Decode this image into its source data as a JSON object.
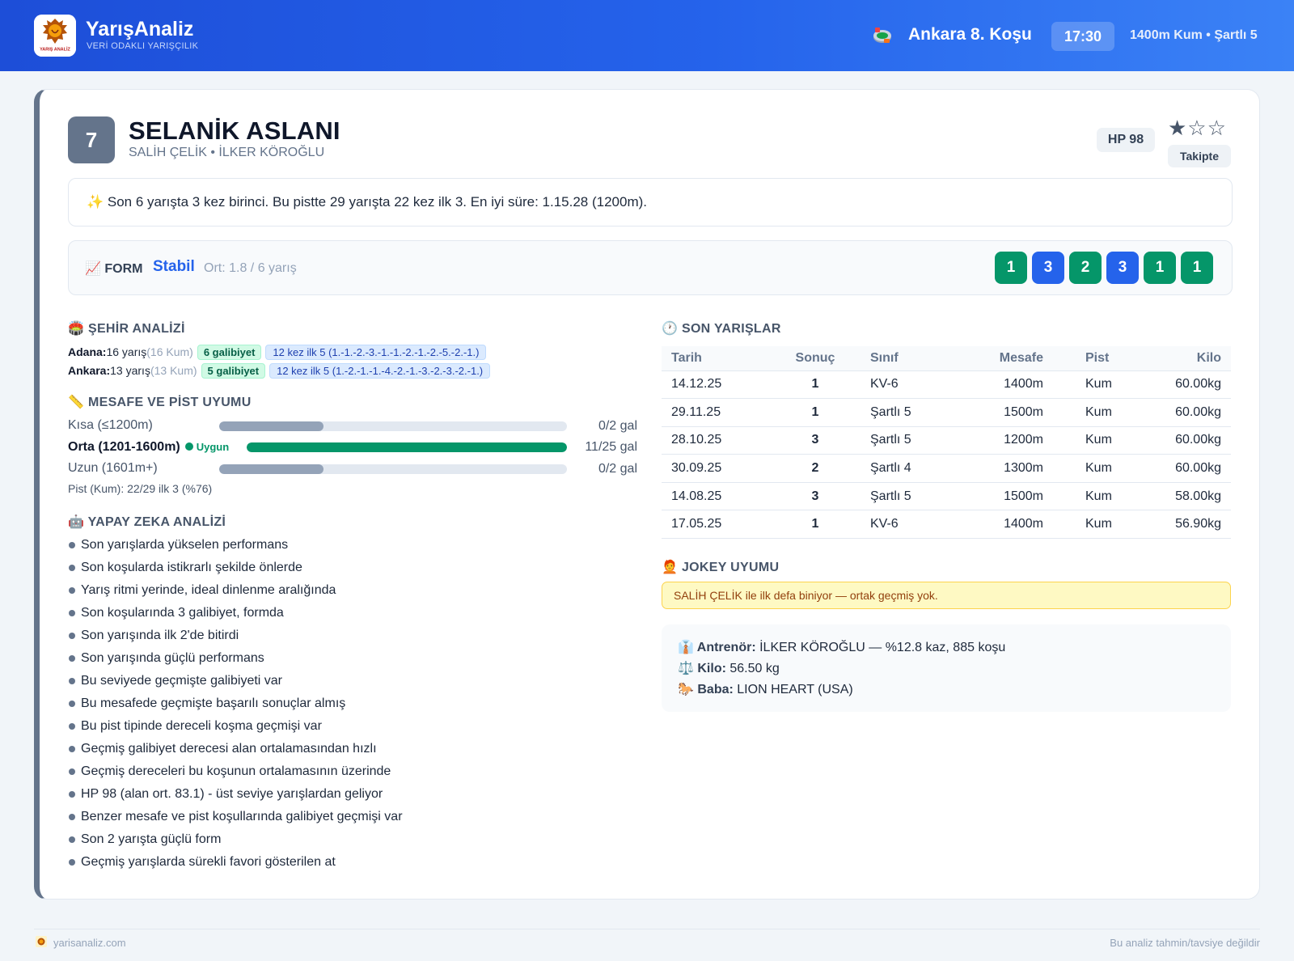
{
  "header": {
    "brand_title": "YarışAnaliz",
    "brand_subtitle": "VERİ ODAKLI YARIŞÇILIK",
    "logo_text": "YARIŞ ANALİZ",
    "race_title": "Ankara 8. Koşu",
    "race_time": "17:30",
    "race_info": "1400m Kum • Şartlı 5"
  },
  "horse": {
    "number": "7",
    "name": "SELANİK ASLANI",
    "people": "SALİH ÇELİK • İLKER KÖROĞLU",
    "hp": "HP 98",
    "stars": "★☆☆",
    "rating_stars": 1,
    "follow_label": "Takipte",
    "summary": "✨ Son 6 yarışta 3 kez birinci. Bu pistte 29 yarışta 22 kez ilk 3. En iyi süre: 1.15.28 (1200m)."
  },
  "form": {
    "label": "📈 FORM",
    "state": "Stabil",
    "average": "Ort: 1.8 / 6 yarış",
    "results": [
      {
        "value": "1",
        "color": "#059669"
      },
      {
        "value": "3",
        "color": "#2563eb"
      },
      {
        "value": "2",
        "color": "#059669"
      },
      {
        "value": "3",
        "color": "#2563eb"
      },
      {
        "value": "1",
        "color": "#059669"
      },
      {
        "value": "1",
        "color": "#059669"
      }
    ]
  },
  "city_analysis": {
    "title": "🏟️ ŞEHİR ANALİZİ",
    "rows": [
      {
        "city": "Adana:",
        "races": " 16 yarış ",
        "surface": "(16 Kum)",
        "wins": "6 galibiyet",
        "top5": "12 kez ilk 5 (1.-1.-2.-3.-1.-1.-2.-1.-2.-5.-2.-1.)"
      },
      {
        "city": "Ankara:",
        "races": " 13 yarış ",
        "surface": "(13 Kum)",
        "wins": "5 galibiyet",
        "top5": "12 kez ilk 5 (1.-2.-1.-1.-4.-2.-1.-3.-2.-3.-2.-1.)"
      }
    ]
  },
  "distance": {
    "title": "📏 MESAFE VE PİST UYUMU",
    "rows": [
      {
        "label": "Kısa (≤1200m)",
        "value": "0/2 gal",
        "fill_pct": 30,
        "good": false,
        "active": false
      },
      {
        "label": "Orta (1201-1600m)",
        "value": "11/25 gal",
        "fill_pct": 100,
        "good": true,
        "active": true,
        "tag": "Uygun"
      },
      {
        "label": "Uzun (1601m+)",
        "value": "0/2 gal",
        "fill_pct": 30,
        "good": false,
        "active": false
      }
    ],
    "pist_line": "Pist (Kum): 22/29 ilk 3 (%76)"
  },
  "ai": {
    "title": "🤖 YAPAY ZEKA ANALİZİ",
    "items": [
      "Son yarışlarda yükselen performans",
      "Son koşularda istikrarlı şekilde önlerde",
      "Yarış ritmi yerinde, ideal dinlenme aralığında",
      "Son koşularında 3 galibiyet, formda",
      "Son yarışında ilk 2'de bitirdi",
      "Son yarışında güçlü performans",
      "Bu seviyede geçmişte galibiyeti var",
      "Bu mesafede geçmişte başarılı sonuçlar almış",
      "Bu pist tipinde dereceli koşma geçmişi var",
      "Geçmiş galibiyet derecesi alan ortalamasından hızlı",
      "Geçmiş dereceleri bu koşunun ortalamasının üzerinde",
      "HP 98 (alan ort. 83.1) - üst seviye yarışlardan geliyor",
      "Benzer mesafe ve pist koşullarında galibiyet geçmişi var",
      "Son 2 yarışta güçlü form",
      "Geçmiş yarışlarda sürekli favori gösterilen at"
    ]
  },
  "recent": {
    "title": "🕐 SON YARIŞLAR",
    "columns": [
      "Tarih",
      "Sonuç",
      "Sınıf",
      "Mesafe",
      "Pist",
      "Kilo"
    ],
    "rows": [
      {
        "date": "14.12.25",
        "result": "1",
        "cls": "KV-6",
        "dist": "1400m",
        "pist": "Kum",
        "kg": "60.00kg"
      },
      {
        "date": "29.11.25",
        "result": "1",
        "cls": "Şartlı 5",
        "dist": "1500m",
        "pist": "Kum",
        "kg": "60.00kg"
      },
      {
        "date": "28.10.25",
        "result": "3",
        "cls": "Şartlı 5",
        "dist": "1200m",
        "pist": "Kum",
        "kg": "60.00kg"
      },
      {
        "date": "30.09.25",
        "result": "2",
        "cls": "Şartlı 4",
        "dist": "1300m",
        "pist": "Kum",
        "kg": "60.00kg"
      },
      {
        "date": "14.08.25",
        "result": "3",
        "cls": "Şartlı 5",
        "dist": "1500m",
        "pist": "Kum",
        "kg": "58.00kg"
      },
      {
        "date": "17.05.25",
        "result": "1",
        "cls": "KV-6",
        "dist": "1400m",
        "pist": "Kum",
        "kg": "56.90kg"
      }
    ]
  },
  "jockey": {
    "title": "🧑‍🦰 JOKEY UYUMU",
    "note": "SALİH ÇELİK ile ilk defa biniyor — ortak geçmiş yok."
  },
  "details": {
    "trainer_label": "👔 Antrenör:",
    "trainer_value": " İLKER KÖROĞLU — %12.8 kaz, 885 koşu",
    "weight_label": "⚖️ Kilo:",
    "weight_value": " 56.50 kg",
    "sire_label": "🐎 Baba:",
    "sire_value": " LION HEART (USA)"
  },
  "footer": {
    "site": "yarisanaliz.com",
    "disclaimer": "Bu analiz tahmin/tavsiye değildir"
  }
}
